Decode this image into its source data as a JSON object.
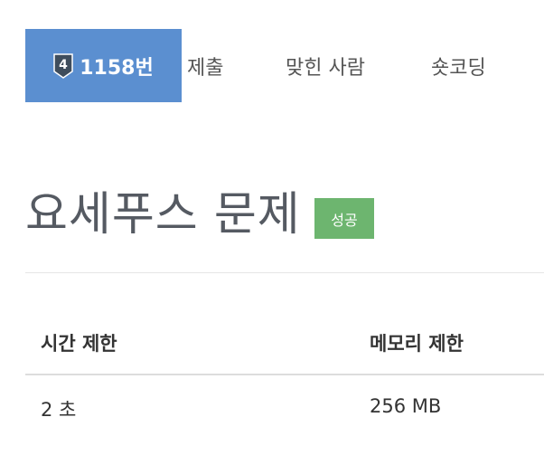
{
  "tabs": {
    "problem": {
      "tier": "4",
      "tier_color": "#3f4d5c",
      "tier_icon": "tier-shield-icon",
      "label": "1158번"
    },
    "submit": "제출",
    "solvers": "맞힌 사람",
    "short_coding": "숏코딩"
  },
  "problem": {
    "title": "요세푸스 문제",
    "status": "성공",
    "status_color": "#6db56f"
  },
  "info": {
    "headers": [
      "시간 제한",
      "메모리 제한"
    ],
    "rows": [
      [
        "2 초",
        "256 MB"
      ]
    ]
  },
  "colors": {
    "active_tab": "#5b8fd0",
    "title_text": "#555a62"
  }
}
